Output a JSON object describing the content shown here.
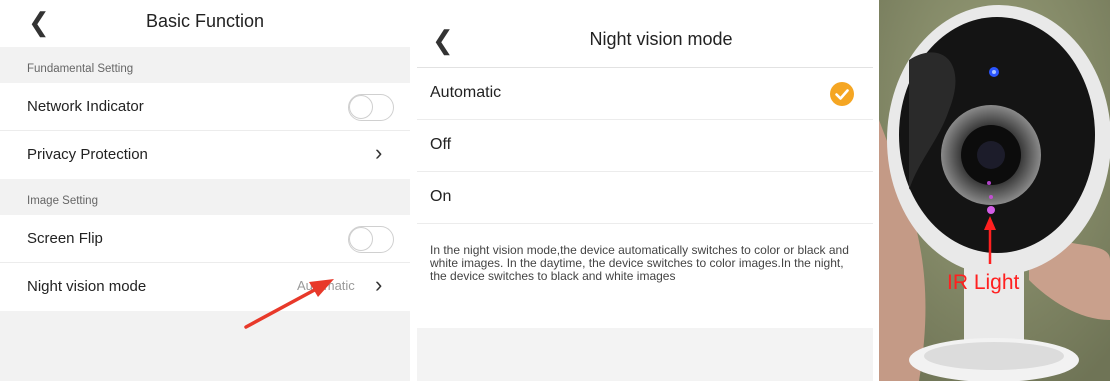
{
  "basic_function": {
    "title": "Basic Function",
    "sections": [
      {
        "label": "Fundamental Setting",
        "items": [
          {
            "label": "Network Indicator"
          },
          {
            "label": "Privacy Protection"
          }
        ]
      },
      {
        "label": "Image Setting",
        "items": [
          {
            "label": "Screen Flip"
          },
          {
            "label": "Night vision mode",
            "value": "Automatic"
          }
        ]
      }
    ]
  },
  "night_vision": {
    "title": "Night vision mode",
    "options": [
      {
        "label": "Automatic",
        "selected": true
      },
      {
        "label": "Off",
        "selected": false
      },
      {
        "label": "On",
        "selected": false
      }
    ],
    "description": "In the night vision mode,the device automatically switches to color or black and white images. In the daytime, the device switches to color images.In the night, the device switches to black and white images"
  },
  "photo": {
    "annotation": "IR Light"
  },
  "colors": {
    "accent_check": "#f5a623",
    "arrow_red": "#e8392a",
    "annotation_red": "#ff2020"
  }
}
